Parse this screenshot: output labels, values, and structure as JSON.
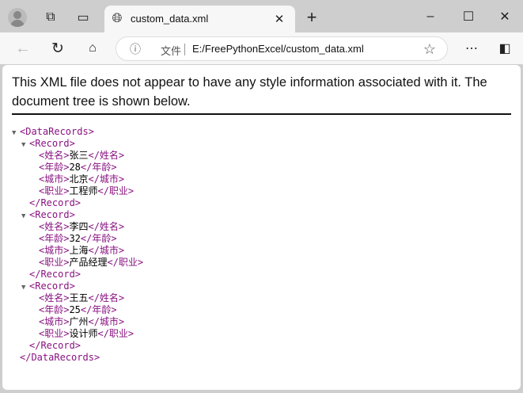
{
  "tab": {
    "title": "custom_data.xml"
  },
  "address": {
    "label": "文件",
    "url": "E:/FreePythonExcel/custom_data.xml"
  },
  "message": "This XML file does not appear to have any style information associated with it. The document tree is shown below.",
  "root": "DataRecords",
  "record_tag": "Record",
  "records": [
    {
      "fields": [
        {
          "tag": "姓名",
          "value": "张三"
        },
        {
          "tag": "年龄",
          "value": "28"
        },
        {
          "tag": "城市",
          "value": "北京"
        },
        {
          "tag": "职业",
          "value": "工程师"
        }
      ]
    },
    {
      "fields": [
        {
          "tag": "姓名",
          "value": "李四"
        },
        {
          "tag": "年龄",
          "value": "32"
        },
        {
          "tag": "城市",
          "value": "上海"
        },
        {
          "tag": "职业",
          "value": "产品经理"
        }
      ]
    },
    {
      "fields": [
        {
          "tag": "姓名",
          "value": "王五"
        },
        {
          "tag": "年龄",
          "value": "25"
        },
        {
          "tag": "城市",
          "value": "广州"
        },
        {
          "tag": "职业",
          "value": "设计师"
        }
      ]
    }
  ],
  "colors": {
    "tag": "#881280"
  }
}
